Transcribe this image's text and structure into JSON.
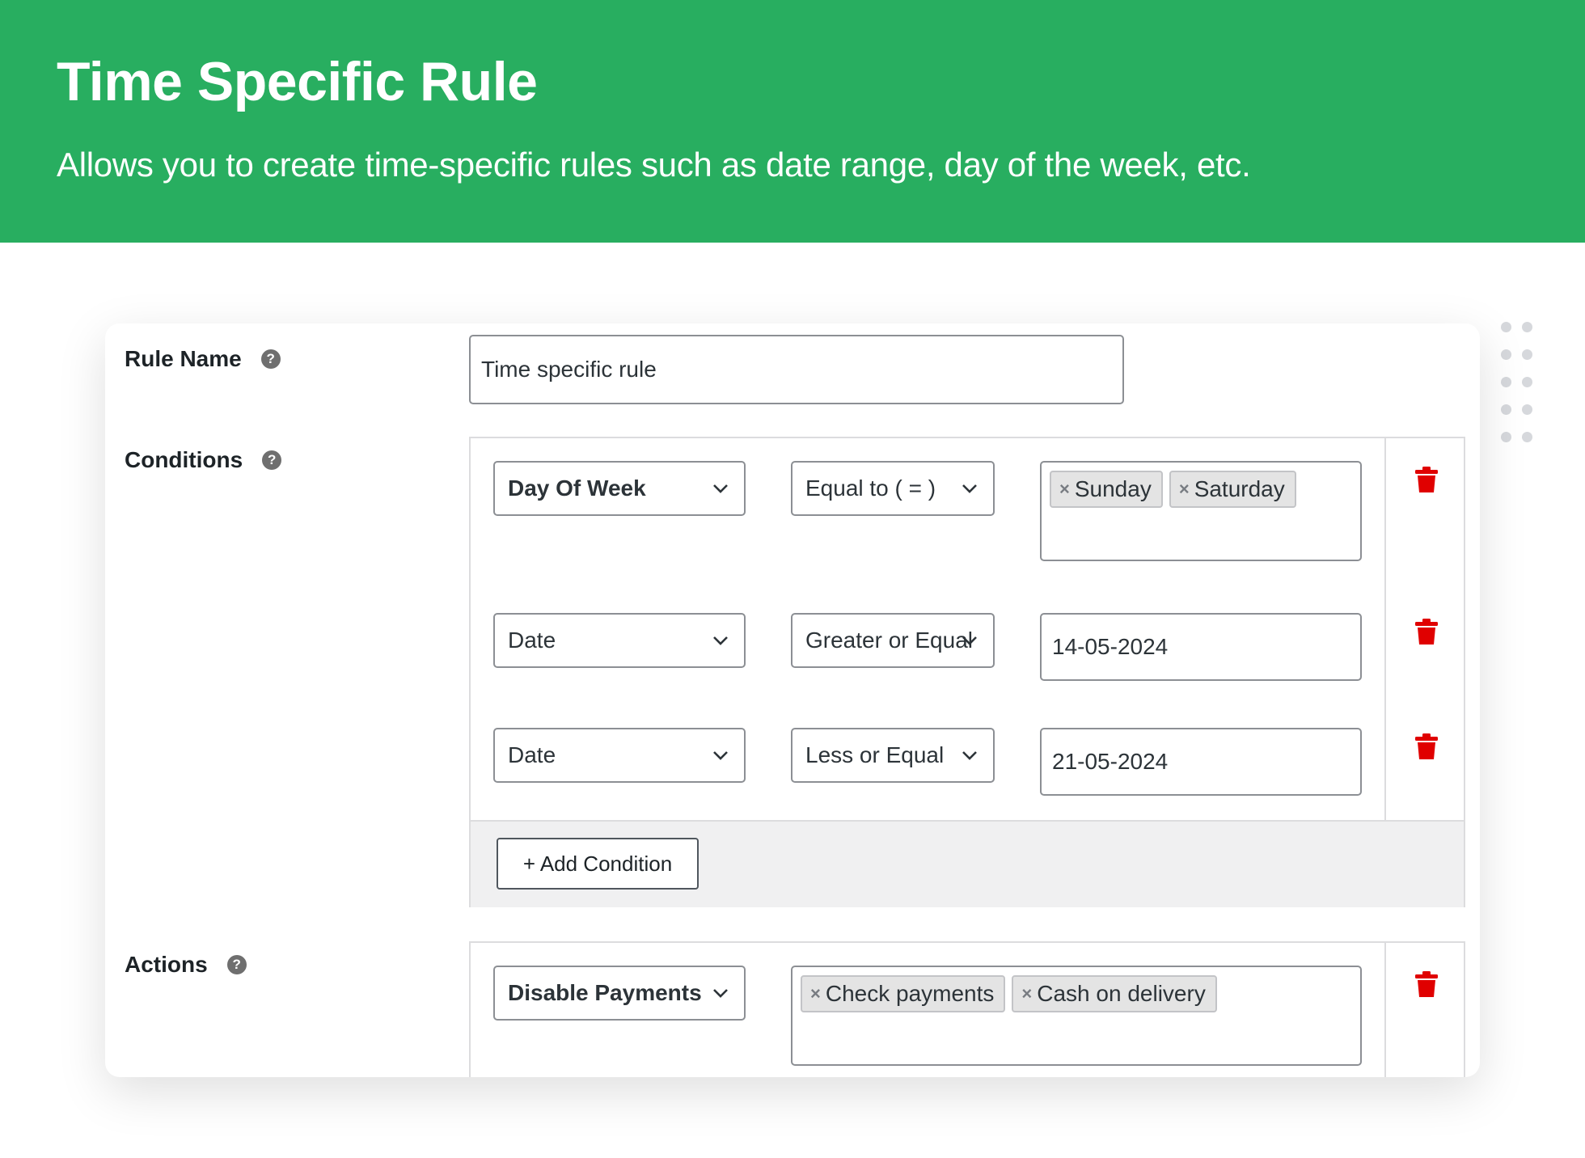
{
  "banner": {
    "title": "Time Specific Rule",
    "subtitle": "Allows you to create time-specific rules such as date range, day of the week, etc."
  },
  "form": {
    "rule_name": {
      "label": "Rule Name",
      "help": "?",
      "value": "Time specific rule"
    },
    "conditions": {
      "label": "Conditions",
      "help": "?",
      "rows": [
        {
          "field": "Day Of Week",
          "operator": "Equal to ( = )",
          "tags": [
            "Sunday",
            "Saturday"
          ]
        },
        {
          "field": "Date",
          "operator": "Greater or Equal",
          "value": "14-05-2024"
        },
        {
          "field": "Date",
          "operator": "Less or Equal",
          "value": "21-05-2024"
        }
      ],
      "add_button": "+ Add Condition"
    },
    "actions": {
      "label": "Actions",
      "help": "?",
      "rows": [
        {
          "action": "Disable Payments",
          "tags": [
            "Check payments",
            "Cash on delivery"
          ]
        }
      ]
    }
  },
  "colors": {
    "banner": "#28ae60",
    "delete": "#e00000"
  },
  "icons": {
    "dropdown": "chevron-down-icon",
    "delete": "trash-icon",
    "help": "help-icon",
    "remove_tag": "close-icon"
  }
}
